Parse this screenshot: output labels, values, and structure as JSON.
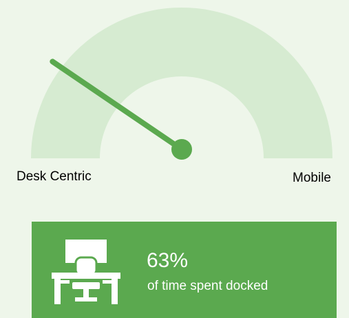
{
  "gauge": {
    "left_label": "Desk Centric",
    "right_label": "Mobile",
    "value_fraction": 0.19,
    "arc_color": "#d6ebd1",
    "needle_color": "#5ba94f"
  },
  "stat": {
    "value": "63%",
    "caption": "of time spent docked",
    "icon": "desk-chair-icon",
    "background_color": "#5ba94f"
  }
}
